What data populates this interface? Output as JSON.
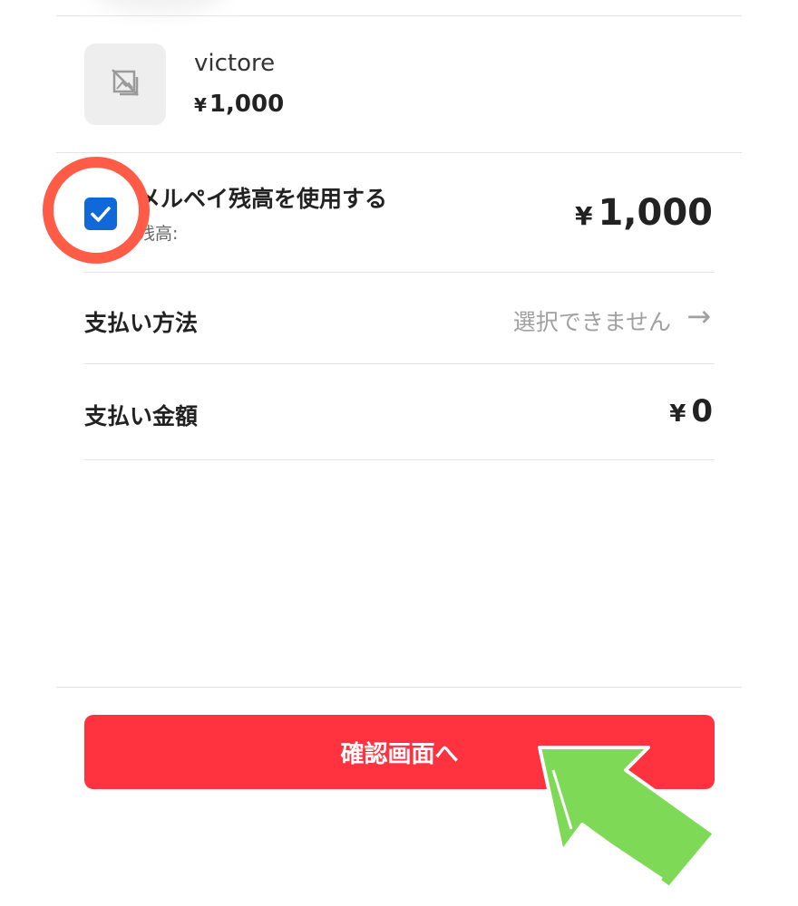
{
  "item": {
    "name": "victore",
    "price_symbol": "¥",
    "price": "1,000",
    "thumbnail_icon": "no-image-icon"
  },
  "balance": {
    "checked": true,
    "title": "メルペイ残高を使用する",
    "subtitle": "残高:",
    "amount_symbol": "¥",
    "amount": "1,000"
  },
  "payment_method": {
    "label": "支払い方法",
    "value": "選択できません",
    "arrow": "→"
  },
  "payment_amount": {
    "label": "支払い金額",
    "symbol": "¥",
    "value": "0"
  },
  "confirm_button": {
    "label": "確認画面へ"
  },
  "colors": {
    "checkbox": "#1168d8",
    "button": "#ff333f",
    "highlight_circle": "#ff5c47",
    "pointer_arrow": "#7ed957"
  }
}
